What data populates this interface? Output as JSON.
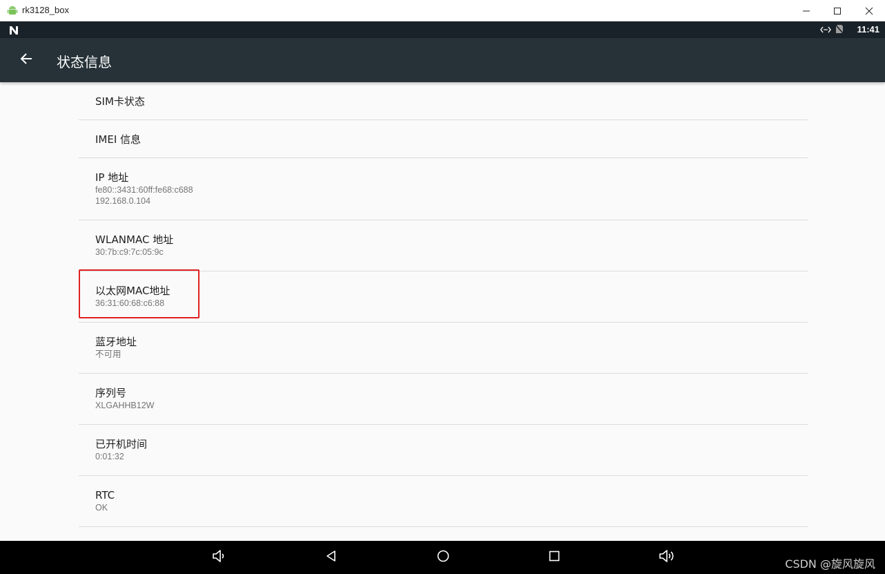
{
  "window": {
    "title": "rk3128_box",
    "app_icon": "android-icon",
    "controls": [
      "minimize-icon",
      "maximize-icon",
      "close-icon"
    ]
  },
  "status_bar": {
    "time": "11:41",
    "icons": [
      "n-notification-icon",
      "ethernet-icon",
      "no-sim-icon"
    ]
  },
  "action_bar": {
    "title": "状态信息",
    "back_icon": "arrow-back-icon"
  },
  "items": [
    {
      "title": "SIM卡状态",
      "summary": []
    },
    {
      "title": "IMEI 信息",
      "summary": []
    },
    {
      "title": "IP 地址",
      "summary": [
        "fe80::3431:60ff:fe68:c688",
        "192.168.0.104"
      ]
    },
    {
      "title": "WLANMAC 地址",
      "summary": [
        "30:7b:c9:7c:05:9c"
      ]
    },
    {
      "title": "以太网MAC地址",
      "summary": [
        "36:31:60:68:c6:88"
      ]
    },
    {
      "title": "蓝牙地址",
      "summary": [
        "不可用"
      ]
    },
    {
      "title": "序列号",
      "summary": [
        "XLGAHHB12W"
      ]
    },
    {
      "title": "已开机时间",
      "summary": [
        "0:01:32"
      ]
    },
    {
      "title": "RTC",
      "summary": [
        "OK"
      ]
    }
  ],
  "highlight": {
    "item": "以太网MAC地址",
    "color": "#e02020"
  },
  "nav_bar": {
    "buttons": [
      "volume-down-icon",
      "back-triangle-icon",
      "home-circle-icon",
      "recents-square-icon",
      "volume-up-icon"
    ]
  },
  "watermark": "CSDN @旋风旋风",
  "colors": {
    "action_bar": "#263238",
    "status_bar": "#192228",
    "background": "#fafafa",
    "divider": "#dcdcdc",
    "highlight": "#e02020"
  }
}
